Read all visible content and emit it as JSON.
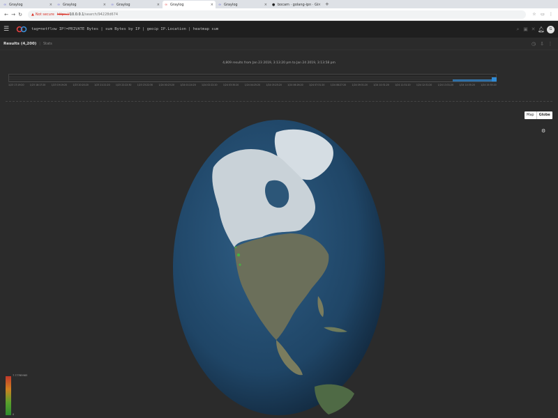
{
  "browser": {
    "tabs": [
      {
        "label": "Graylog"
      },
      {
        "label": "Graylog"
      },
      {
        "label": "Graylog"
      },
      {
        "label": "Graylog",
        "active": true
      },
      {
        "label": "Graylog"
      },
      {
        "label": "bocam · golang-ipn · GitHub"
      }
    ],
    "security_label": "Not secure",
    "url_scheme": "https://",
    "url_host": "10.0.0.1",
    "url_path": "/search/94228d674"
  },
  "header": {
    "query": "tag=netflow IP!=PRIVATE Bytes | sum Bytes by IP | geoip IP.Location | heatmap sum",
    "avatar_initial": "G"
  },
  "results": {
    "title": "Results (4,200)",
    "stats": "Stats"
  },
  "histogram": {
    "summary": "4,809 results from Jan 23 2019, 3:13:20 pm to Jan 24 2019, 3:13:58 pm",
    "ticks": [
      "1/23 17:19:20",
      "1/23 18:17:20",
      "1/23 19:19:20",
      "1/23 20:20:20",
      "1/23 21:21:20",
      "1/23 22:22:30",
      "1/23 23:22:30",
      "1/24 00:23:20",
      "1/24 01:24:20",
      "1/24 02:22:20",
      "1/24 03:30:20",
      "1/24 04:25:20",
      "1/24 05:25:20",
      "1/24 06:26:20",
      "1/24 07:31:20",
      "1/24 08:27:20",
      "1/24 09:31:20",
      "1/24 10:31:20",
      "1/24 11:31:20",
      "1/24 12:31:20",
      "1/24 13:31:20",
      "1/24 14:35:20",
      "1/24 15:35:20"
    ]
  },
  "map": {
    "view_options": [
      "Map",
      "Globe"
    ],
    "selected_view": "Globe"
  },
  "legend": {
    "max_label": "7.77785983",
    "min_label": "0"
  },
  "colors": {
    "accent": "#2f8bd6",
    "header_bg": "#1f1f1f",
    "page_bg": "#2b2b2b"
  }
}
